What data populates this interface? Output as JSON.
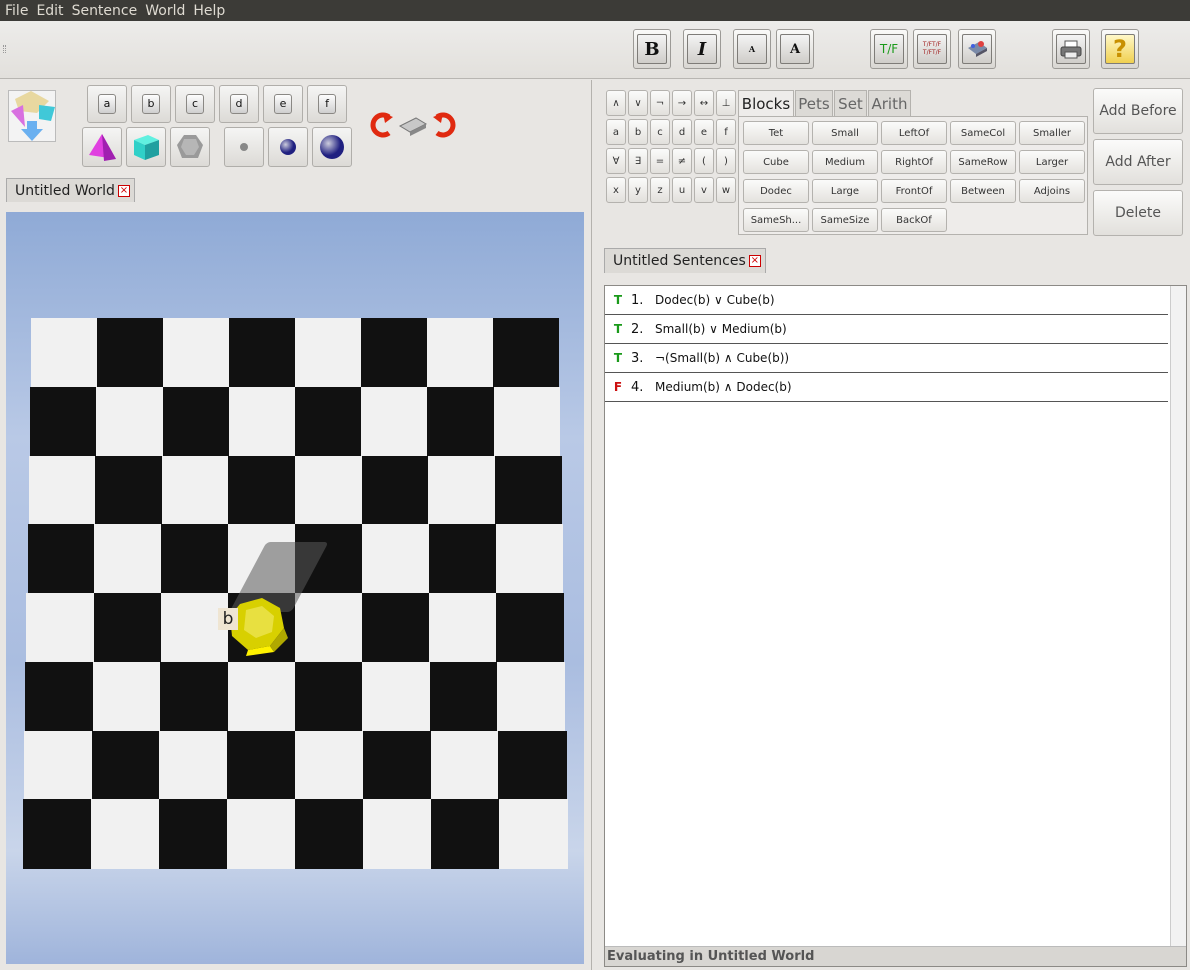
{
  "menu": [
    "File",
    "Edit",
    "Sentence",
    "World",
    "Help"
  ],
  "toolbar": {
    "bold": "B",
    "italic": "I",
    "small_a": "A",
    "large_a": "A",
    "tf": "T/F",
    "tftf": "T/FT/F\nT/FT/F"
  },
  "names": [
    "a",
    "b",
    "c",
    "d",
    "e",
    "f"
  ],
  "world_tab": "Untitled World",
  "world": {
    "object_label": "b",
    "object_shape": "dodec",
    "object_size": "medium",
    "object_color": "#d8d000",
    "colors": {
      "sky": "#9fb4db",
      "white_square": "#f1f1f1",
      "black_square": "#111111"
    }
  },
  "keyboard": [
    [
      "∧",
      "∨",
      "¬",
      "→",
      "↔",
      "⊥"
    ],
    [
      "a",
      "b",
      "c",
      "d",
      "e",
      "f"
    ],
    [
      "∀",
      "∃",
      "=",
      "≠",
      "(",
      ")"
    ],
    [
      "x",
      "y",
      "z",
      "u",
      "v",
      "w"
    ]
  ],
  "palette_tabs": [
    "Blocks",
    "Pets",
    "Set",
    "Arith"
  ],
  "predicates": [
    [
      "Tet",
      "Small",
      "LeftOf",
      "SameCol",
      "Smaller"
    ],
    [
      "Cube",
      "Medium",
      "RightOf",
      "SameRow",
      "Larger"
    ],
    [
      "Dodec",
      "Large",
      "FrontOf",
      "Between",
      "Adjoins"
    ],
    [
      "SameSh...",
      "SameSize",
      "BackOf",
      "",
      ""
    ]
  ],
  "side_buttons": {
    "add_before": "Add Before",
    "add_after": "Add After",
    "delete": "Delete"
  },
  "sentences_tab": "Untitled Sentences",
  "sentences": [
    {
      "value": "T",
      "num": "1.",
      "text": "Dodec(b) ∨ Cube(b)",
      "color": "#1a9a1a"
    },
    {
      "value": "T",
      "num": "2.",
      "text": "Small(b) ∨ Medium(b)",
      "color": "#1a9a1a"
    },
    {
      "value": "T",
      "num": "3.",
      "text": "¬(Small(b) ∧ Cube(b))",
      "color": "#1a9a1a"
    },
    {
      "value": "F",
      "num": "4.",
      "text": "Medium(b) ∧ Dodec(b)",
      "color": "#cc1010"
    }
  ],
  "status": "Evaluating in Untitled World"
}
